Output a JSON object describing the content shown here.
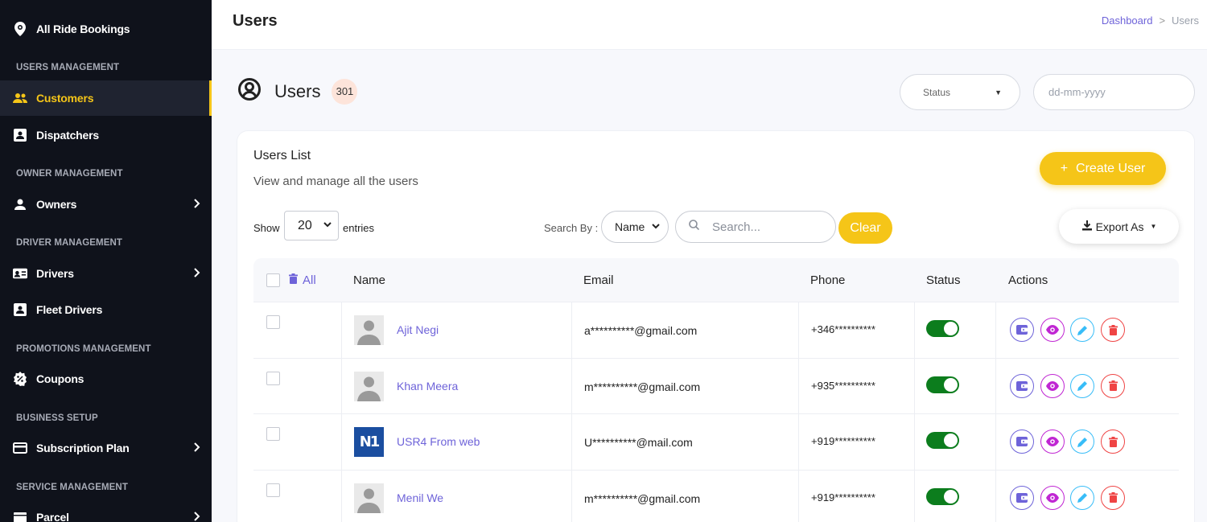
{
  "sidebar": {
    "brand": "All Ride Bookings",
    "sections": {
      "users": "USERS MANAGEMENT",
      "owner": "OWNER MANAGEMENT",
      "driver": "DRIVER MANAGEMENT",
      "promotions": "PROMOTIONS MANAGEMENT",
      "business": "BUSINESS SETUP",
      "service": "SERVICE MANAGEMENT"
    },
    "items": {
      "customers": "Customers",
      "dispatchers": "Dispatchers",
      "owners": "Owners",
      "drivers": "Drivers",
      "fleet_drivers": "Fleet Drivers",
      "coupons": "Coupons",
      "subscription_plan": "Subscription Plan",
      "parcel": "Parcel"
    },
    "active_color": "#f5c518"
  },
  "topbar": {
    "title": "Users",
    "breadcrumb": {
      "home": "Dashboard",
      "separator": ">",
      "current": "Users"
    }
  },
  "header": {
    "title": "Users",
    "count": "301",
    "status_label": "Status",
    "date_placeholder": "dd-mm-yyyy"
  },
  "card": {
    "title": "Users List",
    "subtitle": "View and manage all the users",
    "create_label": "Create User",
    "create_plus": "+",
    "show_label": "Show",
    "entries_value": "20",
    "entries_label": "entries",
    "search_by_label": "Search By :",
    "search_by_value": "Name",
    "search_placeholder": "Search...",
    "clear_label": "Clear",
    "export_label": "Export As"
  },
  "table": {
    "headers": {
      "all": "All",
      "name": "Name",
      "email": "Email",
      "phone": "Phone",
      "status": "Status",
      "actions": "Actions"
    },
    "rows": [
      {
        "name": "Ajit Negi",
        "email": "a**********@gmail.com",
        "phone": "+346**********",
        "avatar": "person"
      },
      {
        "name": "Khan Meera",
        "email": "m**********@gmail.com",
        "phone": "+935**********",
        "avatar": "person"
      },
      {
        "name": "USR4 From web",
        "email": "U**********@mail.com",
        "phone": "+919**********",
        "avatar": "N1"
      },
      {
        "name": "Menil We",
        "email": "m**********@gmail.com",
        "phone": "+919**********",
        "avatar": "person"
      }
    ]
  },
  "colors": {
    "accent": "#f5c518",
    "link": "#6e63d9",
    "toggle_on": "#0c7d1d",
    "wallet": "#6e63d9",
    "view": "#c026d3",
    "edit": "#38bdf8",
    "delete": "#ef4444"
  }
}
